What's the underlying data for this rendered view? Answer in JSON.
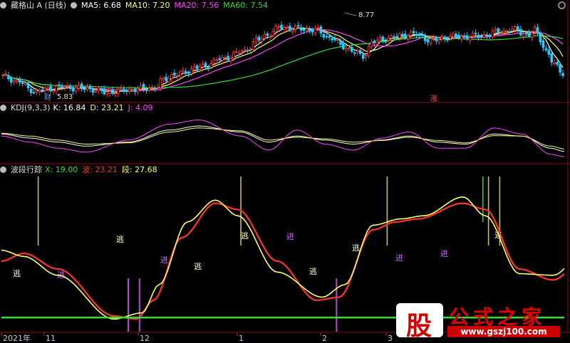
{
  "price_panel": {
    "title": "藏格山 A (日线)",
    "legend": [
      {
        "label": "MA5: 6.68",
        "color": "#ffffff"
      },
      {
        "label": "MA10: 7.20",
        "color": "#ffff66"
      },
      {
        "label": "MA20: 7.56",
        "color": "#ff44ff"
      },
      {
        "label": "MA60: 7.54",
        "color": "#33dd33"
      }
    ],
    "high_label": "8.77",
    "low_label": "5.83",
    "marker_cai": "财",
    "marker_zhang": "涨"
  },
  "kdj_panel": {
    "title": "KDJ(9,3,3)",
    "legend": [
      {
        "label": "K: 16.84",
        "color": "#ffffff"
      },
      {
        "label": "D: 23.21",
        "color": "#ffff66"
      },
      {
        "label": "J: 4.09",
        "color": "#ff44ff"
      }
    ]
  },
  "wave_panel": {
    "title": "波段行踪",
    "legend": [
      {
        "label": "X: 19.00",
        "color": "#33dd33"
      },
      {
        "label": "波: 23.21",
        "color": "#ff3333"
      },
      {
        "label": "段: 27.68",
        "color": "#ffff66"
      }
    ],
    "buy_label": "进",
    "sell_label": "逃"
  },
  "x_axis_labels": [
    "2021年",
    "11",
    "12",
    "1",
    "2",
    "3"
  ],
  "watermark": {
    "char": "股",
    "title": "公式之家",
    "url": "www.gszj100.com"
  },
  "chart_data": [
    {
      "type": "candlestick",
      "title": "藏格山 A (日线)",
      "ylim": [
        5.6,
        9.0
      ],
      "n": 130,
      "close_anchors": [
        [
          0,
          6.55
        ],
        [
          6,
          6.35
        ],
        [
          9,
          6.1
        ],
        [
          12,
          5.95
        ],
        [
          14,
          6.05
        ],
        [
          20,
          6.15
        ],
        [
          30,
          6.1
        ],
        [
          36,
          5.95
        ],
        [
          45,
          6.05
        ],
        [
          55,
          6.15
        ],
        [
          56,
          6.4
        ],
        [
          60,
          6.6
        ],
        [
          70,
          6.9
        ],
        [
          77,
          7.2
        ],
        [
          85,
          7.5
        ],
        [
          90,
          7.9
        ],
        [
          93,
          8.1
        ],
        [
          98,
          8.4
        ],
        [
          104,
          8.35
        ],
        [
          110,
          8.3
        ],
        [
          116,
          8.0
        ],
        [
          120,
          7.7
        ],
        [
          125,
          7.45
        ],
        [
          127,
          7.3
        ],
        [
          131,
          7.85
        ],
        [
          136,
          8.0
        ],
        [
          145,
          8.15
        ],
        [
          152,
          7.9
        ],
        [
          158,
          8.05
        ],
        [
          164,
          8.05
        ],
        [
          170,
          8.1
        ],
        [
          176,
          8.25
        ],
        [
          181,
          8.3
        ],
        [
          186,
          8.1
        ],
        [
          188,
          8.3
        ],
        [
          190,
          7.95
        ],
        [
          192,
          7.5
        ],
        [
          195,
          7.0
        ],
        [
          198,
          6.7
        ]
      ],
      "ma_periods": [
        5,
        10,
        20,
        60
      ],
      "ma_colors": [
        "#ffffff",
        "#ffff66",
        "#ff44ff",
        "#33dd33"
      ]
    },
    {
      "type": "line",
      "title": "KDJ(9,3,3)",
      "ylim": [
        -10,
        110
      ],
      "series": [
        {
          "name": "K",
          "color": "#ffffff",
          "anchors": [
            [
              0,
              60
            ],
            [
              10,
              50
            ],
            [
              20,
              40
            ],
            [
              30,
              30
            ],
            [
              45,
              40
            ],
            [
              60,
              70
            ],
            [
              70,
              80
            ],
            [
              85,
              65
            ],
            [
              95,
              40
            ],
            [
              105,
              55
            ],
            [
              115,
              45
            ],
            [
              125,
              35
            ],
            [
              135,
              45
            ],
            [
              145,
              55
            ],
            [
              155,
              40
            ],
            [
              165,
              35
            ],
            [
              175,
              60
            ],
            [
              185,
              55
            ],
            [
              195,
              25
            ],
            [
              200,
              17
            ]
          ]
        },
        {
          "name": "D",
          "color": "#ffff66",
          "anchors": [
            [
              0,
              62
            ],
            [
              10,
              55
            ],
            [
              20,
              45
            ],
            [
              30,
              35
            ],
            [
              45,
              38
            ],
            [
              60,
              65
            ],
            [
              70,
              75
            ],
            [
              85,
              68
            ],
            [
              95,
              45
            ],
            [
              105,
              52
            ],
            [
              115,
              48
            ],
            [
              125,
              40
            ],
            [
              135,
              44
            ],
            [
              145,
              52
            ],
            [
              155,
              44
            ],
            [
              165,
              38
            ],
            [
              175,
              56
            ],
            [
              185,
              55
            ],
            [
              195,
              30
            ],
            [
              200,
              23
            ]
          ]
        },
        {
          "name": "J",
          "color": "#ff44ff",
          "anchors": [
            [
              0,
              55
            ],
            [
              10,
              40
            ],
            [
              20,
              25
            ],
            [
              30,
              15
            ],
            [
              45,
              45
            ],
            [
              60,
              85
            ],
            [
              70,
              95
            ],
            [
              85,
              55
            ],
            [
              95,
              20
            ],
            [
              105,
              70
            ],
            [
              115,
              35
            ],
            [
              125,
              20
            ],
            [
              135,
              50
            ],
            [
              145,
              65
            ],
            [
              155,
              25
            ],
            [
              165,
              25
            ],
            [
              175,
              75
            ],
            [
              185,
              60
            ],
            [
              195,
              10
            ],
            [
              200,
              4
            ]
          ]
        }
      ]
    },
    {
      "type": "line",
      "title": "波段行踪",
      "ylim": [
        0,
        100
      ],
      "series": [
        {
          "name": "波",
          "color": "#ff3333",
          "anchors": [
            [
              0,
              45
            ],
            [
              4,
              50
            ],
            [
              10,
              40
            ],
            [
              20,
              10
            ],
            [
              24,
              8
            ],
            [
              27,
              20
            ],
            [
              32,
              60
            ],
            [
              38,
              82
            ],
            [
              42,
              78
            ],
            [
              49,
              45
            ],
            [
              56,
              20
            ],
            [
              60,
              22
            ],
            [
              66,
              65
            ],
            [
              70,
              70
            ],
            [
              74,
              72
            ],
            [
              82,
              82
            ],
            [
              86,
              78
            ],
            [
              92,
              40
            ],
            [
              98,
              33
            ],
            [
              106,
              58
            ],
            [
              110,
              50
            ],
            [
              116,
              70
            ],
            [
              124,
              65
            ],
            [
              128,
              45
            ],
            [
              134,
              22
            ],
            [
              140,
              14
            ],
            [
              144,
              22
            ],
            [
              146,
              30
            ],
            [
              150,
              28
            ],
            [
              152,
              25
            ],
            [
              158,
              60
            ],
            [
              164,
              82
            ],
            [
              172,
              82
            ],
            [
              180,
              70
            ],
            [
              188,
              45
            ],
            [
              194,
              20
            ],
            [
              198,
              10
            ]
          ]
        },
        {
          "name": "段",
          "color": "#ffff66",
          "anchors": [
            [
              0,
              52
            ],
            [
              4,
              48
            ],
            [
              10,
              36
            ],
            [
              20,
              8
            ],
            [
              25,
              12
            ],
            [
              28,
              30
            ],
            [
              33,
              70
            ],
            [
              38,
              84
            ],
            [
              42,
              74
            ],
            [
              49,
              38
            ],
            [
              57,
              22
            ],
            [
              61,
              30
            ],
            [
              66,
              68
            ],
            [
              71,
              72
            ],
            [
              75,
              74
            ],
            [
              82,
              86
            ],
            [
              86,
              74
            ],
            [
              92,
              37
            ],
            [
              98,
              36
            ],
            [
              106,
              64
            ],
            [
              110,
              48
            ],
            [
              116,
              74
            ],
            [
              122,
              60
            ],
            [
              128,
              40
            ],
            [
              134,
              20
            ],
            [
              141,
              18
            ],
            [
              144,
              28
            ],
            [
              146,
              31
            ],
            [
              150,
              29
            ],
            [
              152,
              28
            ],
            [
              158,
              66
            ],
            [
              164,
              84
            ],
            [
              172,
              80
            ],
            [
              180,
              66
            ],
            [
              188,
              40
            ],
            [
              194,
              16
            ],
            [
              198,
              10
            ]
          ]
        },
        {
          "name": "X",
          "color": "#33dd33",
          "anchors": [
            [
              0,
              9
            ],
            [
              140,
              9
            ]
          ]
        }
      ],
      "buy_signals": [
        20,
        22,
        57,
        100,
        140,
        154
      ],
      "sell_signals": [
        4,
        40,
        66,
        84,
        86,
        108,
        123,
        126,
        174
      ],
      "green_signals": [
        83,
        122
      ]
    }
  ]
}
